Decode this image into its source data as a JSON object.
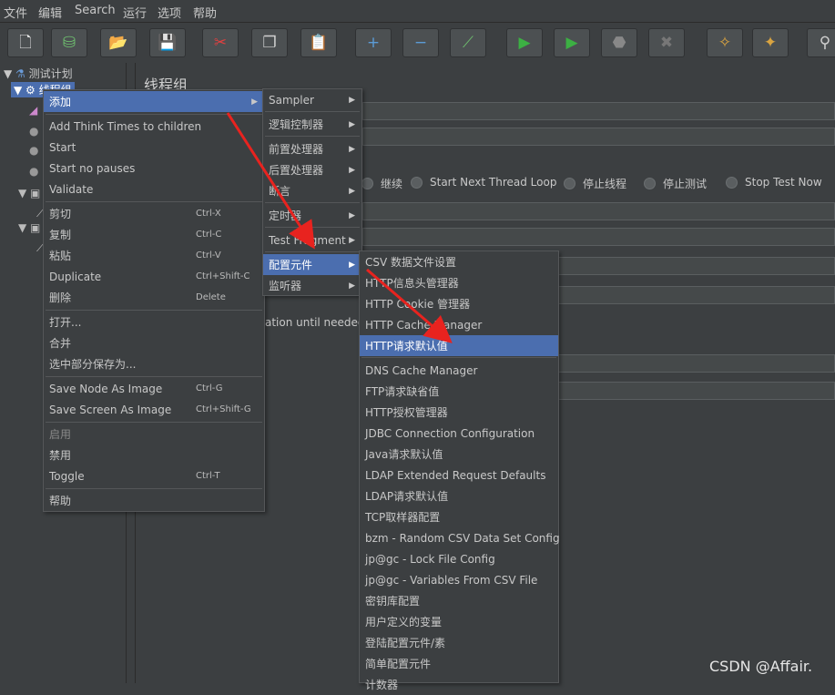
{
  "menubar": [
    "文件",
    "编辑",
    "Search",
    "运行",
    "选项",
    "帮助"
  ],
  "toolbar": [
    {
      "name": "new-icon",
      "glyph": "🗋",
      "color": "#e8e8e8"
    },
    {
      "name": "templates-icon",
      "glyph": "⛁",
      "color": "#6fbf6f"
    },
    {
      "name": "open-icon",
      "glyph": "📂",
      "color": "#e0b040"
    },
    {
      "name": "save-icon",
      "glyph": "💾",
      "color": "#d0d0d0"
    },
    {
      "name": "cut-icon",
      "glyph": "✂",
      "color": "#e04040"
    },
    {
      "name": "copy-icon",
      "glyph": "❐",
      "color": "#d0d0d0"
    },
    {
      "name": "paste-icon",
      "glyph": "📋",
      "color": "#e0b040"
    },
    {
      "name": "expand-icon",
      "glyph": "+",
      "color": "#5b9bd5"
    },
    {
      "name": "collapse-icon",
      "glyph": "−",
      "color": "#5b9bd5"
    },
    {
      "name": "toggle-icon",
      "glyph": "⟋",
      "color": "#6fbf6f"
    },
    {
      "name": "start-icon",
      "glyph": "▶",
      "color": "#3cb043"
    },
    {
      "name": "start-no-pauses-icon",
      "glyph": "▶",
      "color": "#3cb043"
    },
    {
      "name": "stop-icon",
      "glyph": "⬣",
      "color": "#888888"
    },
    {
      "name": "shutdown-icon",
      "glyph": "✖",
      "color": "#777777"
    },
    {
      "name": "clear-icon",
      "glyph": "✧",
      "color": "#d9a441"
    },
    {
      "name": "clear-all-icon",
      "glyph": "✦",
      "color": "#d9a441"
    },
    {
      "name": "search-icon",
      "glyph": "⚲",
      "color": "#d0d0d0"
    }
  ],
  "tree": {
    "root": "测试计划",
    "thread_group": "线程组"
  },
  "panel": {
    "title": "线程组",
    "radios": [
      "继续",
      "Start Next Thread Loop",
      "停止线程",
      "停止测试",
      "Stop Test Now"
    ],
    "partial_text": "ation until needed"
  },
  "context_menu": {
    "add": "添加",
    "items": [
      {
        "label": "Add Think Times to children",
        "shortcut": ""
      },
      {
        "label": "Start",
        "shortcut": ""
      },
      {
        "label": "Start no pauses",
        "shortcut": ""
      },
      {
        "label": "Validate",
        "shortcut": ""
      },
      {
        "label": "剪切",
        "shortcut": "Ctrl-X"
      },
      {
        "label": "复制",
        "shortcut": "Ctrl-C"
      },
      {
        "label": "粘贴",
        "shortcut": "Ctrl-V"
      },
      {
        "label": "Duplicate",
        "shortcut": "Ctrl+Shift-C"
      },
      {
        "label": "删除",
        "shortcut": "Delete"
      },
      {
        "label": "打开...",
        "shortcut": ""
      },
      {
        "label": "合并",
        "shortcut": ""
      },
      {
        "label": "选中部分保存为...",
        "shortcut": ""
      },
      {
        "label": "Save Node As Image",
        "shortcut": "Ctrl-G"
      },
      {
        "label": "Save Screen As Image",
        "shortcut": "Ctrl+Shift-G"
      },
      {
        "label": "启用",
        "shortcut": ""
      },
      {
        "label": "禁用",
        "shortcut": ""
      },
      {
        "label": "Toggle",
        "shortcut": "Ctrl-T"
      },
      {
        "label": "帮助",
        "shortcut": ""
      }
    ]
  },
  "add_submenu": [
    "Sampler",
    "逻辑控制器",
    "前置处理器",
    "后置处理器",
    "断言",
    "定时器",
    "Test Fragment",
    "配置元件",
    "监听器"
  ],
  "config_submenu": [
    "CSV 数据文件设置",
    "HTTP信息头管理器",
    "HTTP Cookie 管理器",
    "HTTP Cache Manager",
    "HTTP请求默认值",
    "DNS Cache Manager",
    "FTP请求缺省值",
    "HTTP授权管理器",
    "JDBC Connection Configuration",
    "Java请求默认值",
    "LDAP Extended Request Defaults",
    "LDAP请求默认值",
    "TCP取样器配置",
    "bzm - Random CSV Data Set Config",
    "jp@gc - Lock File Config",
    "jp@gc - Variables From CSV File",
    "密钥库配置",
    "用户定义的变量",
    "登陆配置元件/素",
    "简单配置元件",
    "计数器"
  ],
  "watermark": "CSDN @Affair.",
  "colors": {
    "background": "#3c3f41",
    "selection": "#4b6eaf",
    "arrow": "#e8231f"
  }
}
